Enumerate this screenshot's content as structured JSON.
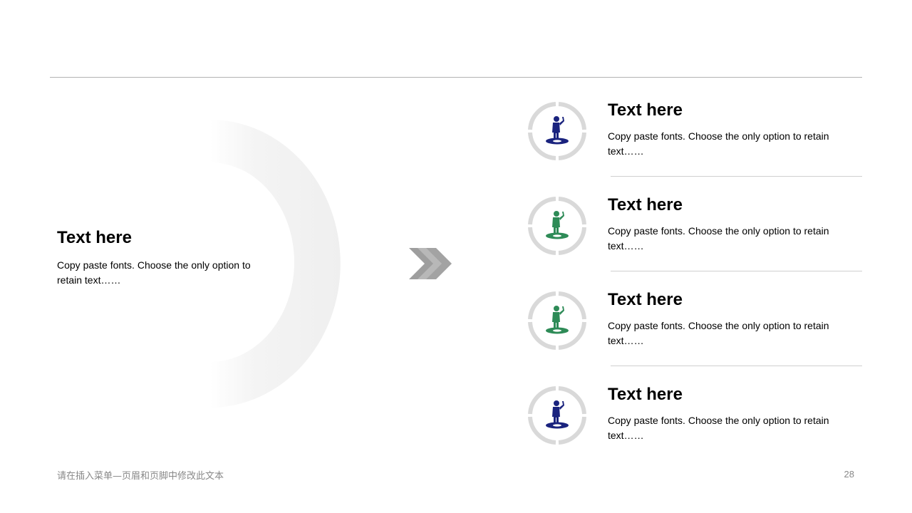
{
  "left": {
    "title": "Text here",
    "text": "Copy paste fonts. Choose the only option to retain text……"
  },
  "items": [
    {
      "title": "Text here",
      "text": "Copy paste fonts. Choose the only option to retain text……",
      "icon": "standing-person-icon",
      "color": "#1a237e"
    },
    {
      "title": "Text here",
      "text": "Copy paste fonts. Choose the only option to retain text……",
      "icon": "standing-person-icon",
      "color": "#2e8b57"
    },
    {
      "title": "Text here",
      "text": "Copy paste fonts. Choose the only option to retain text……",
      "icon": "standing-person-icon",
      "color": "#2e8b57"
    },
    {
      "title": "Text here",
      "text": "Copy paste fonts. Choose the only option to retain text……",
      "icon": "standing-person-icon",
      "color": "#1a237e"
    }
  ],
  "footer": {
    "text": "请在插入菜单—页眉和页脚中修改此文本",
    "page_number": "28"
  },
  "colors": {
    "ring": "#d9d9d9",
    "arc": "#f2f2f2",
    "chevron": "#a6a6a6",
    "rule": "#b3b3b3"
  }
}
